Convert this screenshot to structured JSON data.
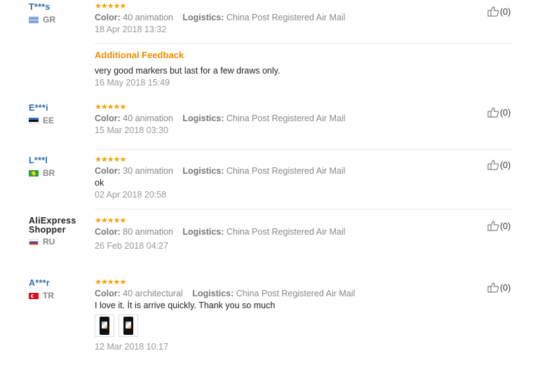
{
  "reviews": [
    {
      "user": "T***s",
      "country": "GR",
      "stars": "★★★★★",
      "color_label": "Color:",
      "color_value": "40 animation",
      "logistics_label": "Logistics:",
      "logistics_value": "China Post Registered Air Mail",
      "date": "18 Apr 2018 13:32",
      "additional_title": "Additional Feedback",
      "additional_text": "very good markers but last for a few draws only.",
      "additional_date": "16 May 2018 15:49",
      "helpful": "(0)"
    },
    {
      "user": "E***i",
      "country": "EE",
      "stars": "★★★★★",
      "color_label": "Color:",
      "color_value": "40 animation",
      "logistics_label": "Logistics:",
      "logistics_value": "China Post Registered Air Mail",
      "date": "15 Mar 2018 03:30",
      "helpful": "(0)"
    },
    {
      "user": "L***l",
      "country": "BR",
      "stars": "★★★★★",
      "color_label": "Color:",
      "color_value": "30 animation",
      "logistics_label": "Logistics:",
      "logistics_value": "China Post Registered Air Mail",
      "text": "ok",
      "date": "02 Apr 2018 20:58",
      "helpful": "(0)"
    },
    {
      "user_line1": "AliExpress",
      "user_line2": "Shopper",
      "country": "RU",
      "stars": "★★★★★",
      "color_label": "Color:",
      "color_value": "80 animation",
      "logistics_label": "Logistics:",
      "logistics_value": "China Post Registered Air Mail",
      "date": "26 Feb 2018 04:27",
      "helpful": "(0)"
    },
    {
      "user": "A***r",
      "country": "TR",
      "stars": "★★★★★",
      "color_label": "Color:",
      "color_value": "40 architectural",
      "logistics_label": "Logistics:",
      "logistics_value": "China Post Registered Air Mail",
      "text": "I love it. İt is arrive quickly. Thank you so much",
      "date": "12 Mar 2018 10:17",
      "helpful": "(0)"
    }
  ],
  "icons": {
    "helpful": "thumbs-up-icon",
    "stars": "star-rating-icon"
  },
  "colors": {
    "username": "#2f6ab1",
    "stars": "#f5a200",
    "additional_feedback": "#f08c00"
  }
}
